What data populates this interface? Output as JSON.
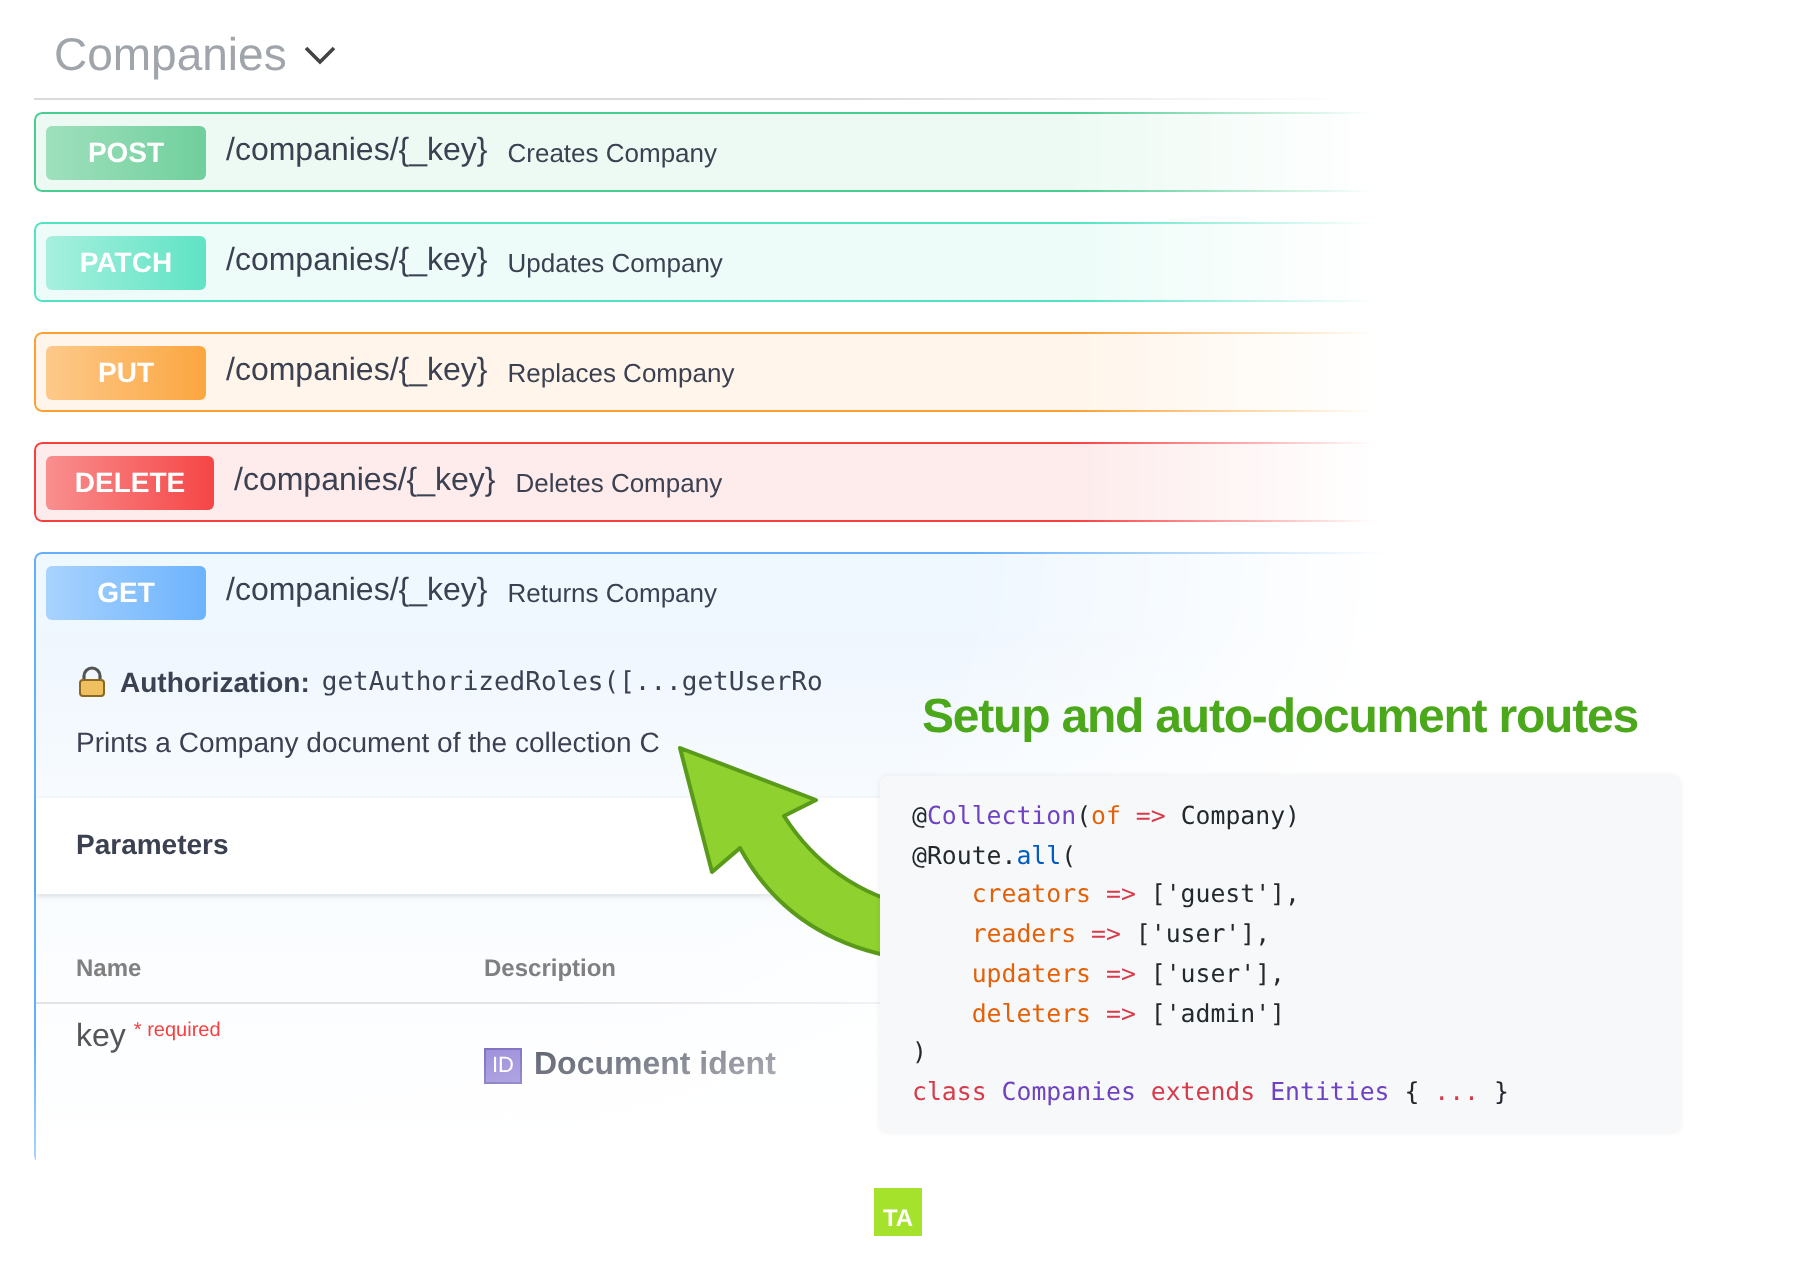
{
  "section": {
    "title": "Companies",
    "expanded": true
  },
  "operations": [
    {
      "method": "POST",
      "kind": "post",
      "path": "/companies/{_key}",
      "summary": "Creates Company",
      "expanded": false
    },
    {
      "method": "PATCH",
      "kind": "patch",
      "path": "/companies/{_key}",
      "summary": "Updates Company",
      "expanded": false
    },
    {
      "method": "PUT",
      "kind": "put",
      "path": "/companies/{_key}",
      "summary": "Replaces Company",
      "expanded": false
    },
    {
      "method": "DELETE",
      "kind": "delete",
      "path": "/companies/{_key}",
      "summary": "Deletes Company",
      "expanded": false
    },
    {
      "method": "GET",
      "kind": "get",
      "path": "/companies/{_key}",
      "summary": "Returns Company",
      "expanded": true
    }
  ],
  "details": {
    "authorization_label": "Authorization:",
    "authorization_code": "getAuthorizedRoles([...getUserRo",
    "description": "Prints a Company document of the collection C",
    "parameters_title": "Parameters",
    "columns": [
      "Name",
      "Description"
    ],
    "parameter": {
      "name": "key",
      "required": "* required",
      "badge": "ID",
      "description": "Document ident"
    }
  },
  "promo": {
    "heading": "Setup and auto-document routes",
    "logo": "TA",
    "code": [
      [
        {
          "text": "@",
          "kind": "plain"
        },
        {
          "text": "Collection",
          "kind": "type"
        },
        {
          "text": "(",
          "kind": "plain"
        },
        {
          "text": "of",
          "kind": "prop"
        },
        {
          "text": " =>",
          "kind": "op"
        },
        {
          "text": " Company)",
          "kind": "plain"
        }
      ],
      [
        {
          "text": "@Route.",
          "kind": "plain"
        },
        {
          "text": "all",
          "kind": "func"
        },
        {
          "text": "(",
          "kind": "plain"
        }
      ],
      [
        {
          "text": "    creators",
          "kind": "prop"
        },
        {
          "text": " =>",
          "kind": "op"
        },
        {
          "text": " ['guest'],",
          "kind": "plain"
        }
      ],
      [
        {
          "text": "    readers",
          "kind": "prop"
        },
        {
          "text": " =>",
          "kind": "op"
        },
        {
          "text": " ['user'],",
          "kind": "plain"
        }
      ],
      [
        {
          "text": "    updaters",
          "kind": "prop"
        },
        {
          "text": " =>",
          "kind": "op"
        },
        {
          "text": " ['user'],",
          "kind": "plain"
        }
      ],
      [
        {
          "text": "    deleters",
          "kind": "prop"
        },
        {
          "text": " =>",
          "kind": "op"
        },
        {
          "text": " ['admin']",
          "kind": "plain"
        }
      ],
      [
        {
          "text": ")",
          "kind": "plain"
        }
      ],
      [
        {
          "text": "class",
          "kind": "keyword"
        },
        {
          "text": " Companies",
          "kind": "type"
        },
        {
          "text": " extends",
          "kind": "keyword"
        },
        {
          "text": " Entities",
          "kind": "type"
        },
        {
          "text": " { ",
          "kind": "plain"
        },
        {
          "text": "...",
          "kind": "keyword"
        },
        {
          "text": " }",
          "kind": "plain"
        }
      ]
    ]
  }
}
